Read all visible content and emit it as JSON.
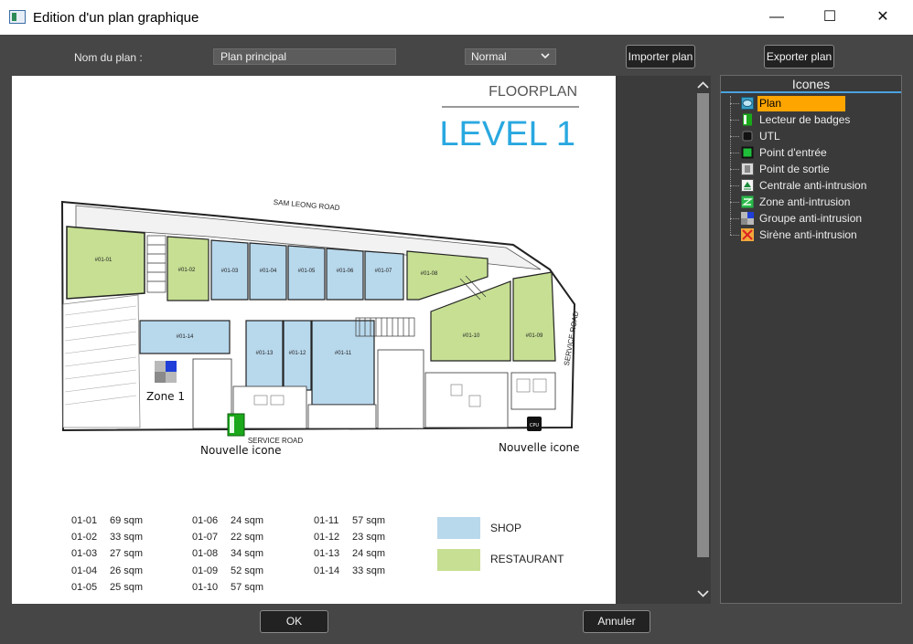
{
  "window": {
    "title": "Edition d'un plan graphique",
    "min_glyph": "—",
    "max_glyph": "☐",
    "close_glyph": "✕"
  },
  "form": {
    "name_label": "Nom du plan :",
    "name_value": "Plan principal",
    "mode_value": "Normal",
    "import_label": "Importer plan",
    "export_label": "Exporter plan",
    "ok_label": "OK",
    "cancel_label": "Annuler"
  },
  "plan": {
    "header_small": "FLOORPLAN",
    "header_big": "LEVEL 1",
    "road_top": "SAM LEONG ROAD",
    "road_bottom": "SERVICE ROAD",
    "road_right": "SERVICE ROAD",
    "units": [
      "#01-01",
      "#01-02",
      "#01-03",
      "#01-04",
      "#01-05",
      "#01-06",
      "#01-07",
      "#01-08",
      "#01-09",
      "#01-10",
      "#01-11",
      "#01-12",
      "#01-13",
      "#01-14"
    ],
    "zone_label": "Zone 1",
    "icon_label_1": "Nouvelle icone",
    "icon_label_2": "Nouvelle icone",
    "cpu_text": "CPU",
    "areas": [
      [
        {
          "id": "01-01",
          "size": "69 sqm"
        },
        {
          "id": "01-02",
          "size": "33 sqm"
        },
        {
          "id": "01-03",
          "size": "27 sqm"
        },
        {
          "id": "01-04",
          "size": "26 sqm"
        },
        {
          "id": "01-05",
          "size": "25 sqm"
        }
      ],
      [
        {
          "id": "01-06",
          "size": "24 sqm"
        },
        {
          "id": "01-07",
          "size": "22 sqm"
        },
        {
          "id": "01-08",
          "size": "34 sqm"
        },
        {
          "id": "01-09",
          "size": "52 sqm"
        },
        {
          "id": "01-10",
          "size": "57 sqm"
        }
      ],
      [
        {
          "id": "01-11",
          "size": "57 sqm"
        },
        {
          "id": "01-12",
          "size": "23 sqm"
        },
        {
          "id": "01-13",
          "size": "24 sqm"
        },
        {
          "id": "01-14",
          "size": "33 sqm"
        }
      ]
    ],
    "legend_shop": "SHOP",
    "legend_restaurant": "RESTAURANT",
    "colors": {
      "shop": "#b8d8ec",
      "restaurant": "#c6df93",
      "accent": "#29a8e0"
    }
  },
  "icons_panel": {
    "title": "Icones",
    "items": [
      {
        "label": "Plan",
        "icon": "plan-icon"
      },
      {
        "label": "Lecteur de badges",
        "icon": "badge-reader-icon"
      },
      {
        "label": "UTL",
        "icon": "utl-icon"
      },
      {
        "label": "Point d'entrée",
        "icon": "entry-point-icon"
      },
      {
        "label": "Point de sortie",
        "icon": "exit-point-icon"
      },
      {
        "label": "Centrale anti-intrusion",
        "icon": "intrusion-central-icon"
      },
      {
        "label": "Zone anti-intrusion",
        "icon": "intrusion-zone-icon"
      },
      {
        "label": "Groupe anti-intrusion",
        "icon": "intrusion-group-icon"
      },
      {
        "label": "Sirène anti-intrusion",
        "icon": "siren-icon"
      }
    ]
  }
}
